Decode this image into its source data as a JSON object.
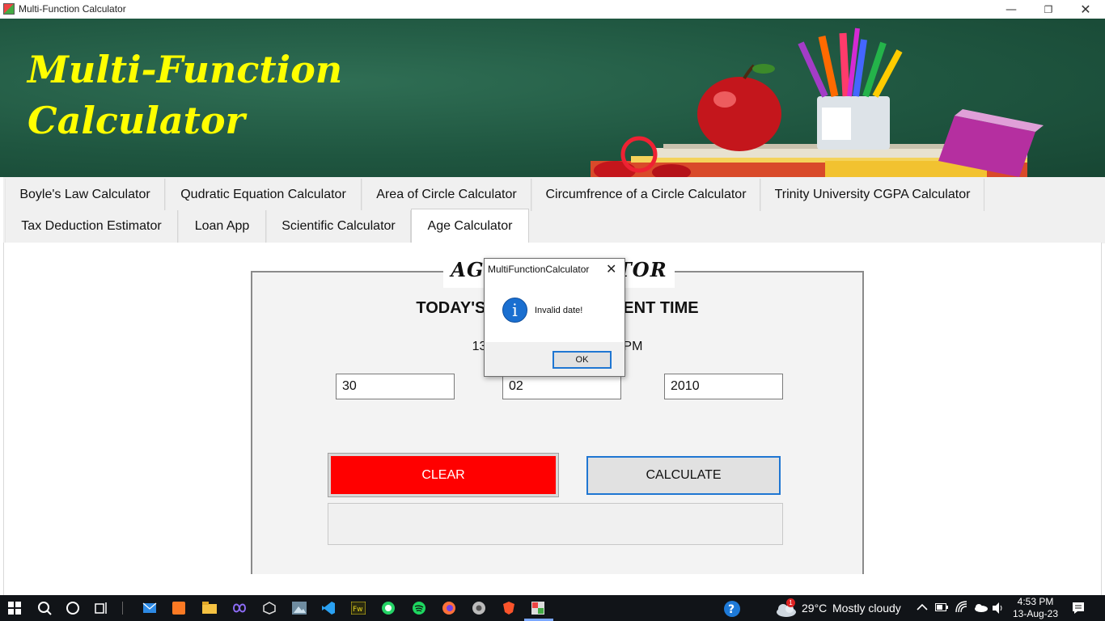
{
  "window": {
    "title": "Multi-Function Calculator",
    "min": "—",
    "max": "❐",
    "close": "✕"
  },
  "banner": {
    "title_line1": "Multi-Function",
    "title_line2": "Calculator"
  },
  "tabs": [
    {
      "label": "Boyle's Law Calculator",
      "active": false
    },
    {
      "label": "Qudratic Equation Calculator",
      "active": false
    },
    {
      "label": "Area of Circle Calculator",
      "active": false
    },
    {
      "label": "Circumfrence of a Circle Calculator",
      "active": false
    },
    {
      "label": "Trinity University CGPA Calculator",
      "active": false
    },
    {
      "label": "Tax Deduction Estimator",
      "active": false
    },
    {
      "label": "Loan App",
      "active": false
    },
    {
      "label": "Scientific Calculator",
      "active": false
    },
    {
      "label": "Age Calculator",
      "active": true
    }
  ],
  "age_calc": {
    "group_title": "AGE CALCULATOR",
    "heading": "TODAY'S DATE AND CURRENT TIME",
    "time_display": "13:08:28   August 13, 2023   PM",
    "day_value": "30",
    "month_value": "02",
    "year_value": "2010",
    "clear_label": "CLEAR",
    "calculate_label": "CALCULATE",
    "result": ""
  },
  "dialog": {
    "title": "MultiFunctionCalculator",
    "close": "✕",
    "icon": "i",
    "message": "Invalid date!",
    "ok_label": "OK"
  },
  "taskbar": {
    "weather_temp": "29°C",
    "weather_text": "Mostly cloudy",
    "time": "4:53 PM",
    "date": "13-Aug-23",
    "weather_badge": "1"
  }
}
